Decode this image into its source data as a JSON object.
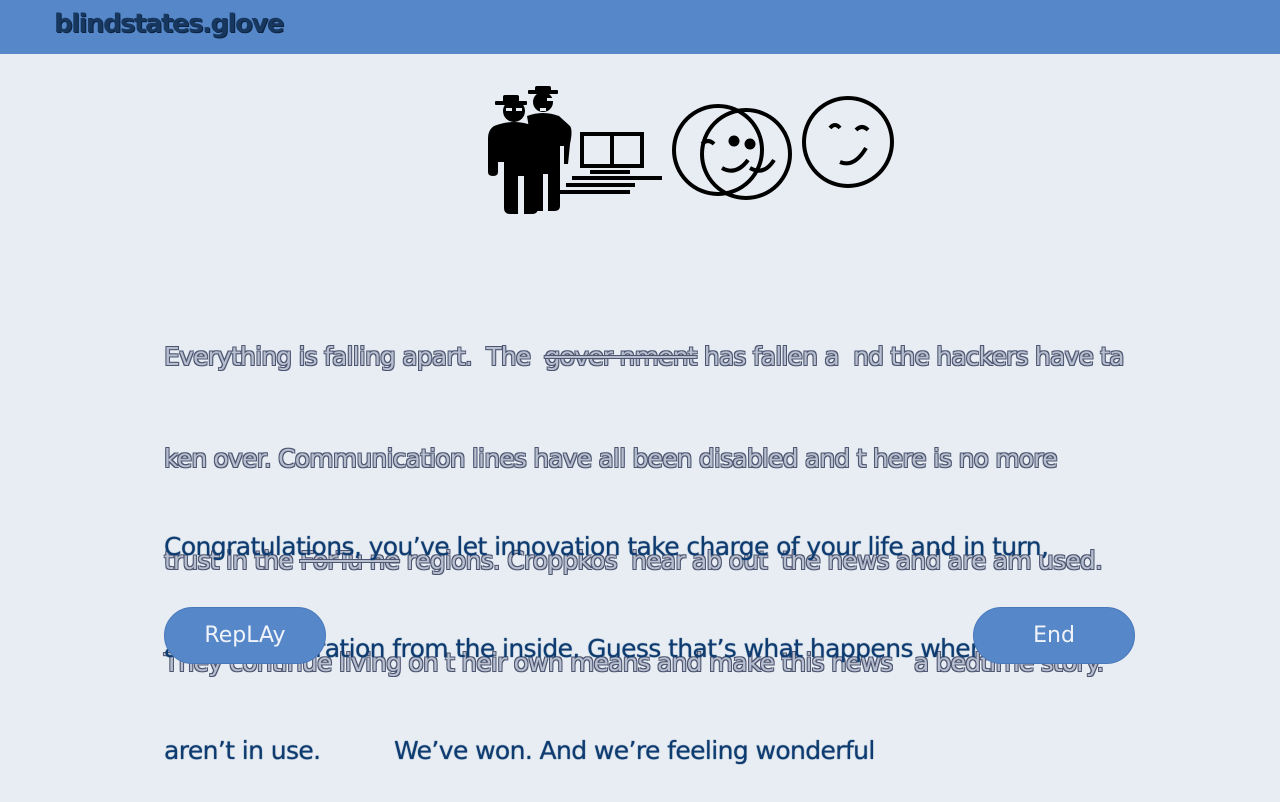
{
  "header": {
    "brand": "blindstates.glove"
  },
  "hero": {
    "icons": [
      "hackers-icon",
      "computers-icon",
      "overlapping-smiley-icon",
      "winking-smiley-icon"
    ]
  },
  "story": {
    "line1_a": "Everything is falling apart.  The  ",
    "line1_strike": "gover nment",
    "line1_b": " has fallen a  nd the hackers have ta",
    "line2": "ken over. Communication lines have all been disabled and t here is no more",
    "line3_a": "trust in the ",
    "line3_strike": "ForTu ne",
    "line3_b": " regions. Croppkos  hear ab out  the news and are am used.",
    "line4": "They continue living on t heir own means and make this news   a bedtime story."
  },
  "message": {
    "line1": "Congratulations, you’ve let innovation take charge of your life and in turn,",
    "line2": "allowed infiltration from the inside. Guess that’s what happens when brains",
    "line3": "aren’t in use.          We’ve won. And we’re feeling wonderful"
  },
  "actions": {
    "replay_label": "RepLAy",
    "end_label": "End"
  },
  "colors": {
    "header_bg": "#5687c9",
    "page_bg": "#e7edf2",
    "brand_text": "#17375e",
    "message_text": "#0e3b70",
    "button_bg": "#5687c9"
  }
}
